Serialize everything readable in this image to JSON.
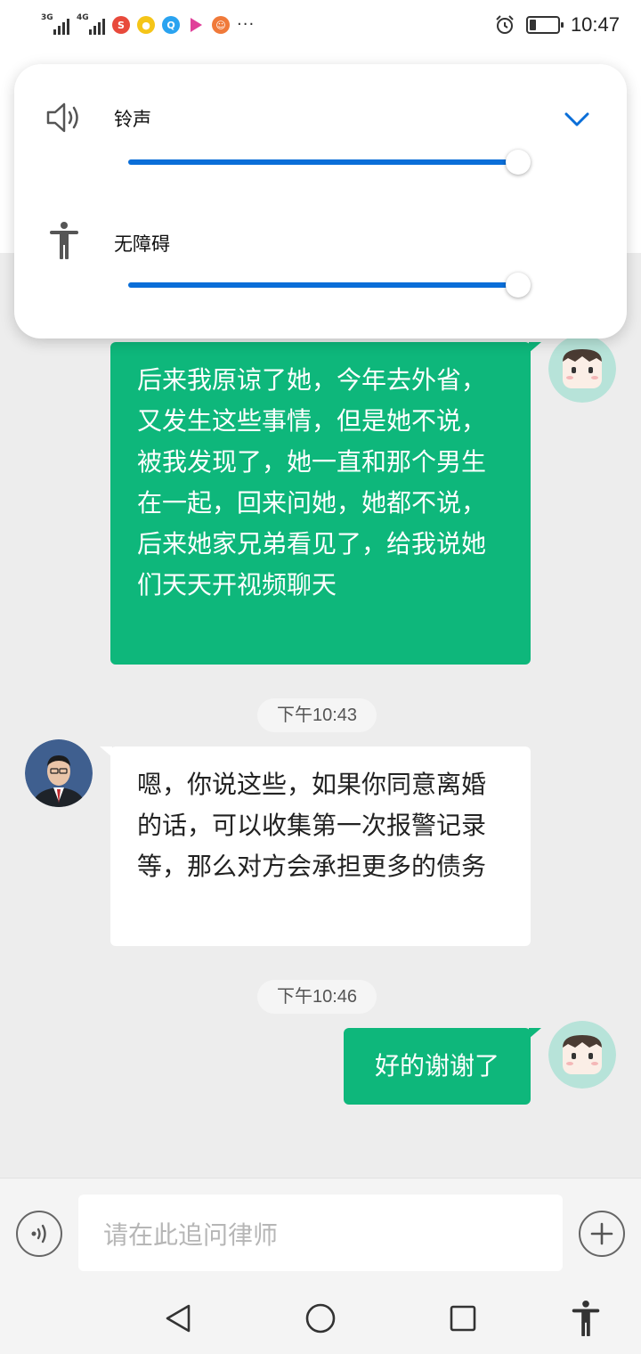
{
  "status_bar": {
    "signal1_label": "3G",
    "signal2_label": "4G",
    "more": "···",
    "time": "10:47",
    "battery_level": 0.25
  },
  "volume_panel": {
    "ringtone_label": "铃声",
    "ringtone_level": 1.0,
    "accessibility_label": "无障碍",
    "accessibility_level": 1.0
  },
  "messages": [
    {
      "from": "me",
      "text": "后来我原谅了她，今年去外省，又发生这些事情，但是她不说，被我发现了，她一直和那个男生在一起，回来问她，她都不说，后来她家兄弟看见了，给我说她们天天开视频聊天"
    },
    {
      "timestamp": "下午10:43"
    },
    {
      "from": "lawyer",
      "text": "嗯，你说这些，如果你同意离婚的话，可以收集第一次报警记录等，那么对方会承担更多的债务"
    },
    {
      "timestamp": "下午10:46"
    },
    {
      "from": "me",
      "text": "好的谢谢了"
    }
  ],
  "input": {
    "placeholder": "请在此追问律师"
  },
  "colors": {
    "accent": "#0a6ed8",
    "my_bubble": "#0eb77b",
    "background": "#ededed"
  }
}
